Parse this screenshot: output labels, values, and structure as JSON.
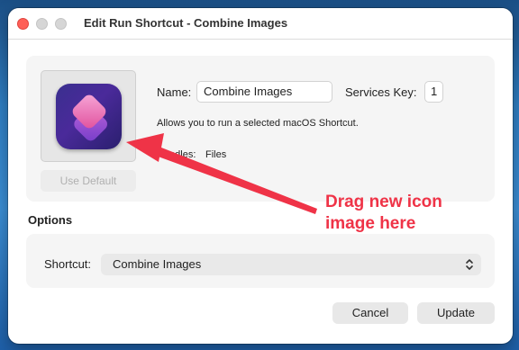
{
  "window": {
    "title": "Edit Run Shortcut - Combine Images"
  },
  "form": {
    "name_label": "Name:",
    "name_value": "Combine Images",
    "services_key_label": "Services Key:",
    "services_key_value": "1",
    "description": "Allows you to run a selected macOS Shortcut.",
    "handles_label": "Handles:",
    "handles_value": "Files",
    "use_default_label": "Use Default",
    "app_icon": "shortcuts-app-icon"
  },
  "options": {
    "section_title": "Options",
    "shortcut_label": "Shortcut:",
    "shortcut_value": "Combine Images"
  },
  "buttons": {
    "cancel": "Cancel",
    "update": "Update"
  },
  "annotation": {
    "line1": "Drag new icon",
    "line2": "image here",
    "color": "#ef3347"
  },
  "colors": {
    "close": "#fe5f57",
    "inactive": "#d6d6d6"
  }
}
